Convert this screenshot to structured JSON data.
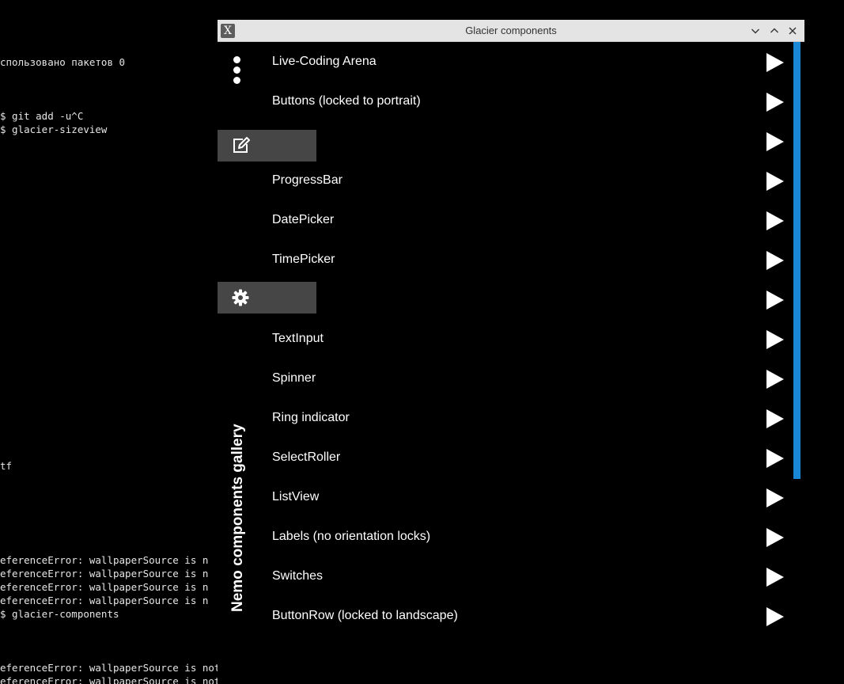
{
  "terminal": {
    "lines": [
      "спользовано пакетов 0",
      "$ git add -u^C",
      "$ glacier-sizeview",
      "tf",
      "eferenceError: wallpaperSource is n",
      "eferenceError: wallpaperSource is n",
      "eferenceError: wallpaperSource is n",
      "eferenceError: wallpaperSource is n",
      "$ glacier-components",
      "eferenceError: wallpaperSource is not defined",
      "eferenceError: wallpaperSource is not defined"
    ]
  },
  "window": {
    "title": "Glacier components",
    "app_icon_glyph": "X",
    "controls": [
      "minimize",
      "maximize",
      "close"
    ]
  },
  "sidebar": {
    "menu_icon": "vertical-dots-icon",
    "tabs": [
      {
        "icon": "edit-icon"
      },
      {
        "icon": "gear-icon"
      }
    ],
    "title": "Nemo components gallery"
  },
  "components": [
    {
      "label": "Live-Coding Arena"
    },
    {
      "label": "Buttons (locked to portrait)"
    },
    {
      "label": ""
    },
    {
      "label": "ProgressBar"
    },
    {
      "label": "DatePicker"
    },
    {
      "label": "TimePicker"
    },
    {
      "label": ""
    },
    {
      "label": "TextInput"
    },
    {
      "label": "Spinner"
    },
    {
      "label": "Ring indicator"
    },
    {
      "label": "SelectRoller"
    },
    {
      "label": "ListView"
    },
    {
      "label": "Labels (no orientation locks)"
    },
    {
      "label": "Switches"
    },
    {
      "label": "ButtonRow (locked to landscape)"
    }
  ],
  "colors": {
    "background": "#000000",
    "titlebar": "#e4e4e4",
    "tab": "#464646",
    "accent_scrollbar": "#1a86d6",
    "text": "#ffffff"
  }
}
